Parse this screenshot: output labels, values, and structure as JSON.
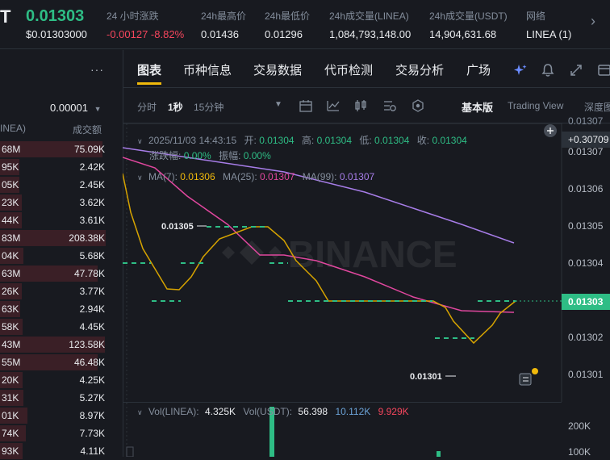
{
  "header": {
    "symbol_tail": "T",
    "price": "0.01303",
    "price_usd": "$0.01303000",
    "stats": [
      {
        "label": "24 小时涨跌",
        "value": "-0.00127 -8.82%"
      },
      {
        "label": "24h最高价",
        "value": "0.01436"
      },
      {
        "label": "24h最低价",
        "value": "0.01296"
      },
      {
        "label": "24h成交量(LINEA)",
        "value": "1,084,793,148.00"
      },
      {
        "label": "24h成交量(USDT)",
        "value": "14,904,631.68"
      },
      {
        "label": "网络",
        "value": "LINEA (1)"
      }
    ],
    "more_arrow": "›"
  },
  "orderbook": {
    "menu_dots": "···",
    "precision": "0.00001",
    "col_left": "INEA)",
    "col_right": "成交额",
    "rows": [
      {
        "a": "68M",
        "b": "75.09K",
        "fill": 0.95
      },
      {
        "a": "95K",
        "b": "2.42K",
        "fill": 0.18
      },
      {
        "a": "05K",
        "b": "2.45K",
        "fill": 0.18
      },
      {
        "a": "23K",
        "b": "3.62K",
        "fill": 0.2
      },
      {
        "a": "44K",
        "b": "3.61K",
        "fill": 0.2
      },
      {
        "a": "83M",
        "b": "208.38K",
        "fill": 0.98
      },
      {
        "a": "04K",
        "b": "5.68K",
        "fill": 0.22
      },
      {
        "a": "63M",
        "b": "47.78K",
        "fill": 0.9
      },
      {
        "a": "26K",
        "b": "3.77K",
        "fill": 0.2
      },
      {
        "a": "63K",
        "b": "2.94K",
        "fill": 0.19
      },
      {
        "a": "58K",
        "b": "4.45K",
        "fill": 0.21
      },
      {
        "a": "43M",
        "b": "123.58K",
        "fill": 0.97
      },
      {
        "a": "55M",
        "b": "46.48K",
        "fill": 0.9
      },
      {
        "a": "20K",
        "b": "4.25K",
        "fill": 0.21
      },
      {
        "a": "31K",
        "b": "5.27K",
        "fill": 0.22
      },
      {
        "a": "01K",
        "b": "8.97K",
        "fill": 0.25
      },
      {
        "a": "74K",
        "b": "7.73K",
        "fill": 0.24
      },
      {
        "a": "93K",
        "b": "4.11K",
        "fill": 0.21
      }
    ]
  },
  "tabs": [
    "图表",
    "币种信息",
    "交易数据",
    "代币检测",
    "交易分析",
    "广场"
  ],
  "toolbar": {
    "time_label": "分时",
    "interval_active": "1秒",
    "interval_other": "15分钟",
    "mode_basic": "基本版",
    "mode_tv": "Trading View",
    "mode_depth": "深度图"
  },
  "ohlc": {
    "date": "2025/11/03 14:43:15",
    "open_label": "开:",
    "open": "0.01304",
    "high_label": "高:",
    "high": "0.01304",
    "low_label": "低:",
    "low": "0.01304",
    "close_label": "收:",
    "close": "0.01304",
    "chg_label": "涨跌幅:",
    "chg": "0.00%",
    "amp_label": "振幅:",
    "amp": "0.00%"
  },
  "ma": {
    "ma7_label": "MA(7):",
    "ma7": "0.01306",
    "ma25_label": "MA(25):",
    "ma25": "0.01307",
    "ma99_label": "MA(99):",
    "ma99": "0.01307"
  },
  "yaxis": {
    "top_badge": "+0.30709",
    "labels": [
      "0.01307",
      "0.01306",
      "0.01305",
      "0.01304",
      "0.01303",
      "0.01302",
      "0.01301"
    ],
    "current": "0.01303"
  },
  "annotations": {
    "high_marker": "0.01305",
    "low_marker": "0.01301"
  },
  "volume": {
    "vol_linea_label": "Vol(LINEA):",
    "vol_linea": "4.325K",
    "vol_usdt_label": "Vol(USDT):",
    "vol_usdt": "56.398",
    "v1": "10.112K",
    "v2": "9.929K",
    "axis": [
      "200K",
      "100K"
    ]
  },
  "watermark": "BINANCE",
  "colors": {
    "up": "#2ebd85",
    "down": "#f6465d",
    "ma7": "#f0b90b",
    "ma25": "#e0479e",
    "ma99": "#a77de8"
  }
}
